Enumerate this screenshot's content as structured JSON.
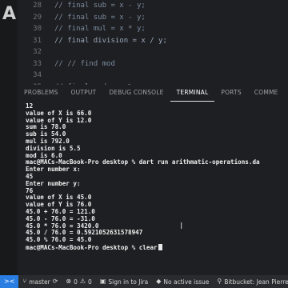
{
  "editor": {
    "lines": [
      {
        "num": "28",
        "code": "// final sub = x - y;"
      },
      {
        "num": "29",
        "code": "// final sub = x - y;"
      },
      {
        "num": "30",
        "code": "// final mul = x * y;"
      },
      {
        "num": "31",
        "code": "// final division = x / y;"
      },
      {
        "num": "32",
        "code": ""
      },
      {
        "num": "33",
        "code": "// // find mod"
      },
      {
        "num": "34",
        "code": ""
      },
      {
        "num": "35",
        "code": "// final mod = x % y;"
      }
    ]
  },
  "panel": {
    "tabs": [
      "PROBLEMS",
      "OUTPUT",
      "DEBUG CONSOLE",
      "TERMINAL",
      "PORTS",
      "COMME"
    ],
    "active_tab": "TERMINAL"
  },
  "terminal": {
    "lines": [
      "12",
      "value of X is 66.0",
      "value of Y is 12.0",
      "sum is 78.0",
      "sub is 54.0",
      "mul is 792.0",
      "division is 5.5",
      "mod is 6.0",
      "mac@MACs-MacBook-Pro desktop % dart run arithmatic-operations.da",
      "Enter number x:",
      "45",
      "Enter number y:",
      "76",
      "value of X is 45.0",
      "value of Y is 76.0",
      "45.0 + 76.0 = 121.0",
      "45.0 - 76.0 = -31.0",
      "45.0 * 76.0 = 3420.0",
      "45.0 / 76.0 = 0.5921052631578947",
      "45.0 % 76.0 = 45.0",
      "mac@MACs-MacBook-Pro desktop % clear"
    ]
  },
  "status": {
    "branch": "master",
    "errors": "0",
    "warnings": "0",
    "jira": "Sign in to Jira",
    "issue": "No active issue",
    "bitbucket": "Bitbucket: Jean Pierre Sc"
  },
  "icons": {
    "remote": "remote-icon",
    "branch": "branch-icon",
    "sync": "sync-icon",
    "error": "error-icon",
    "warning": "warning-icon",
    "jira": "jira-icon",
    "issue": "issue-icon",
    "bitbucket": "bitbucket-icon"
  },
  "colors": {
    "accent": "#2a7de1",
    "background": "#1e1f22"
  }
}
